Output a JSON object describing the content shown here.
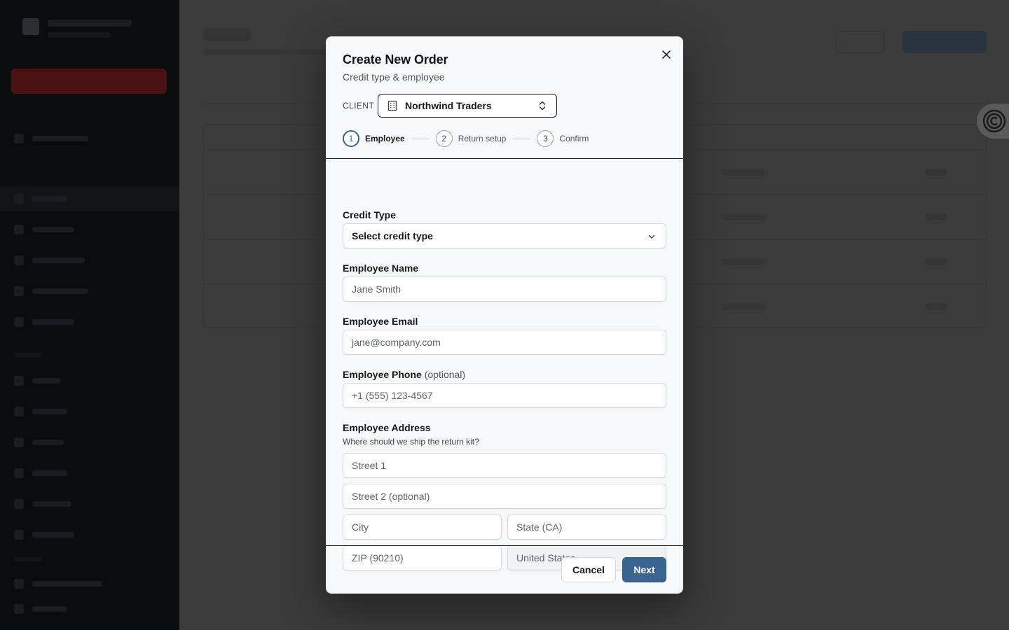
{
  "modal": {
    "title": "Create New Order",
    "subtitle": "Credit type & employee",
    "client_label": "CLIENT",
    "client_value": "Northwind Traders",
    "steps": [
      {
        "number": "1",
        "label": "Employee",
        "active": true
      },
      {
        "number": "2",
        "label": "Return setup",
        "active": false
      },
      {
        "number": "3",
        "label": "Confirm",
        "active": false
      }
    ]
  },
  "form": {
    "credit_type": {
      "label": "Credit Type",
      "value": "Select credit type"
    },
    "employee_name": {
      "label": "Employee Name",
      "placeholder": "Jane Smith"
    },
    "employee_email": {
      "label": "Employee Email",
      "placeholder": "jane@company.com"
    },
    "employee_phone": {
      "label": "Employee Phone",
      "optional": "(optional)",
      "placeholder": "+1 (555) 123-4567"
    },
    "employee_address": {
      "label": "Employee Address",
      "help": "Where should we ship the return kit?",
      "street1": "Street 1",
      "street2": "Street 2 (optional)",
      "city": "City",
      "state": "State (CA)",
      "zip": "ZIP (90210)",
      "country": "United States"
    }
  },
  "footer": {
    "cancel_label": "Cancel",
    "next_label": "Next"
  },
  "colors": {
    "primary": "#3a6591",
    "overlay": "#3b3b3b",
    "sidebar": "#0b0c0e"
  },
  "icons": [
    "close-icon",
    "building-icon",
    "chevron-up-down-icon",
    "chevron-down-icon",
    "support-icon"
  ]
}
